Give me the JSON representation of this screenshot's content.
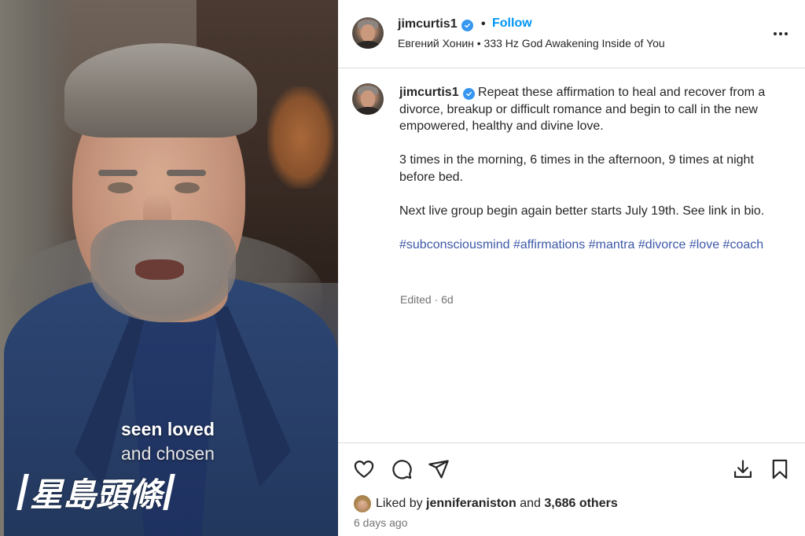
{
  "video": {
    "caption_line1": "seen loved",
    "caption_line2": "and chosen",
    "watermark": "星島頭條"
  },
  "post": {
    "username": "jimcurtis1",
    "verified": true,
    "follow_label": "Follow",
    "separator": "•",
    "audio_credit": "Евгений Хонин • 333 Hz God Awakening Inside of You",
    "more_icon": "more-options-icon"
  },
  "caption": {
    "username": "jimcurtis1",
    "paragraph1": "Repeat these affirmation to heal and recover from a divorce, breakup or difficult romance and begin to call in the new empowered, healthy and divine love.",
    "paragraph2": "3 times in the morning, 6 times in the afternoon, 9 times at night before bed.",
    "paragraph3": "Next live group begin again better starts July 19th. See link in bio.",
    "hashtags": [
      "#subconsciousmind",
      "#affirmations",
      "#mantra",
      "#divorce",
      "#love",
      "#coach"
    ],
    "meta": "Edited · 6d"
  },
  "actions": {
    "liked_by_prefix": "Liked by",
    "liked_by_user": "jenniferaniston",
    "liked_by_and": "and",
    "others_count": "3,686 others",
    "timestamp": "6 days ago"
  },
  "colors": {
    "link_blue": "#0095f6",
    "verified_blue": "#3797f0",
    "hashtag_blue": "#3d58a8",
    "muted_gray": "#737373",
    "divider": "#dbdbdb"
  }
}
